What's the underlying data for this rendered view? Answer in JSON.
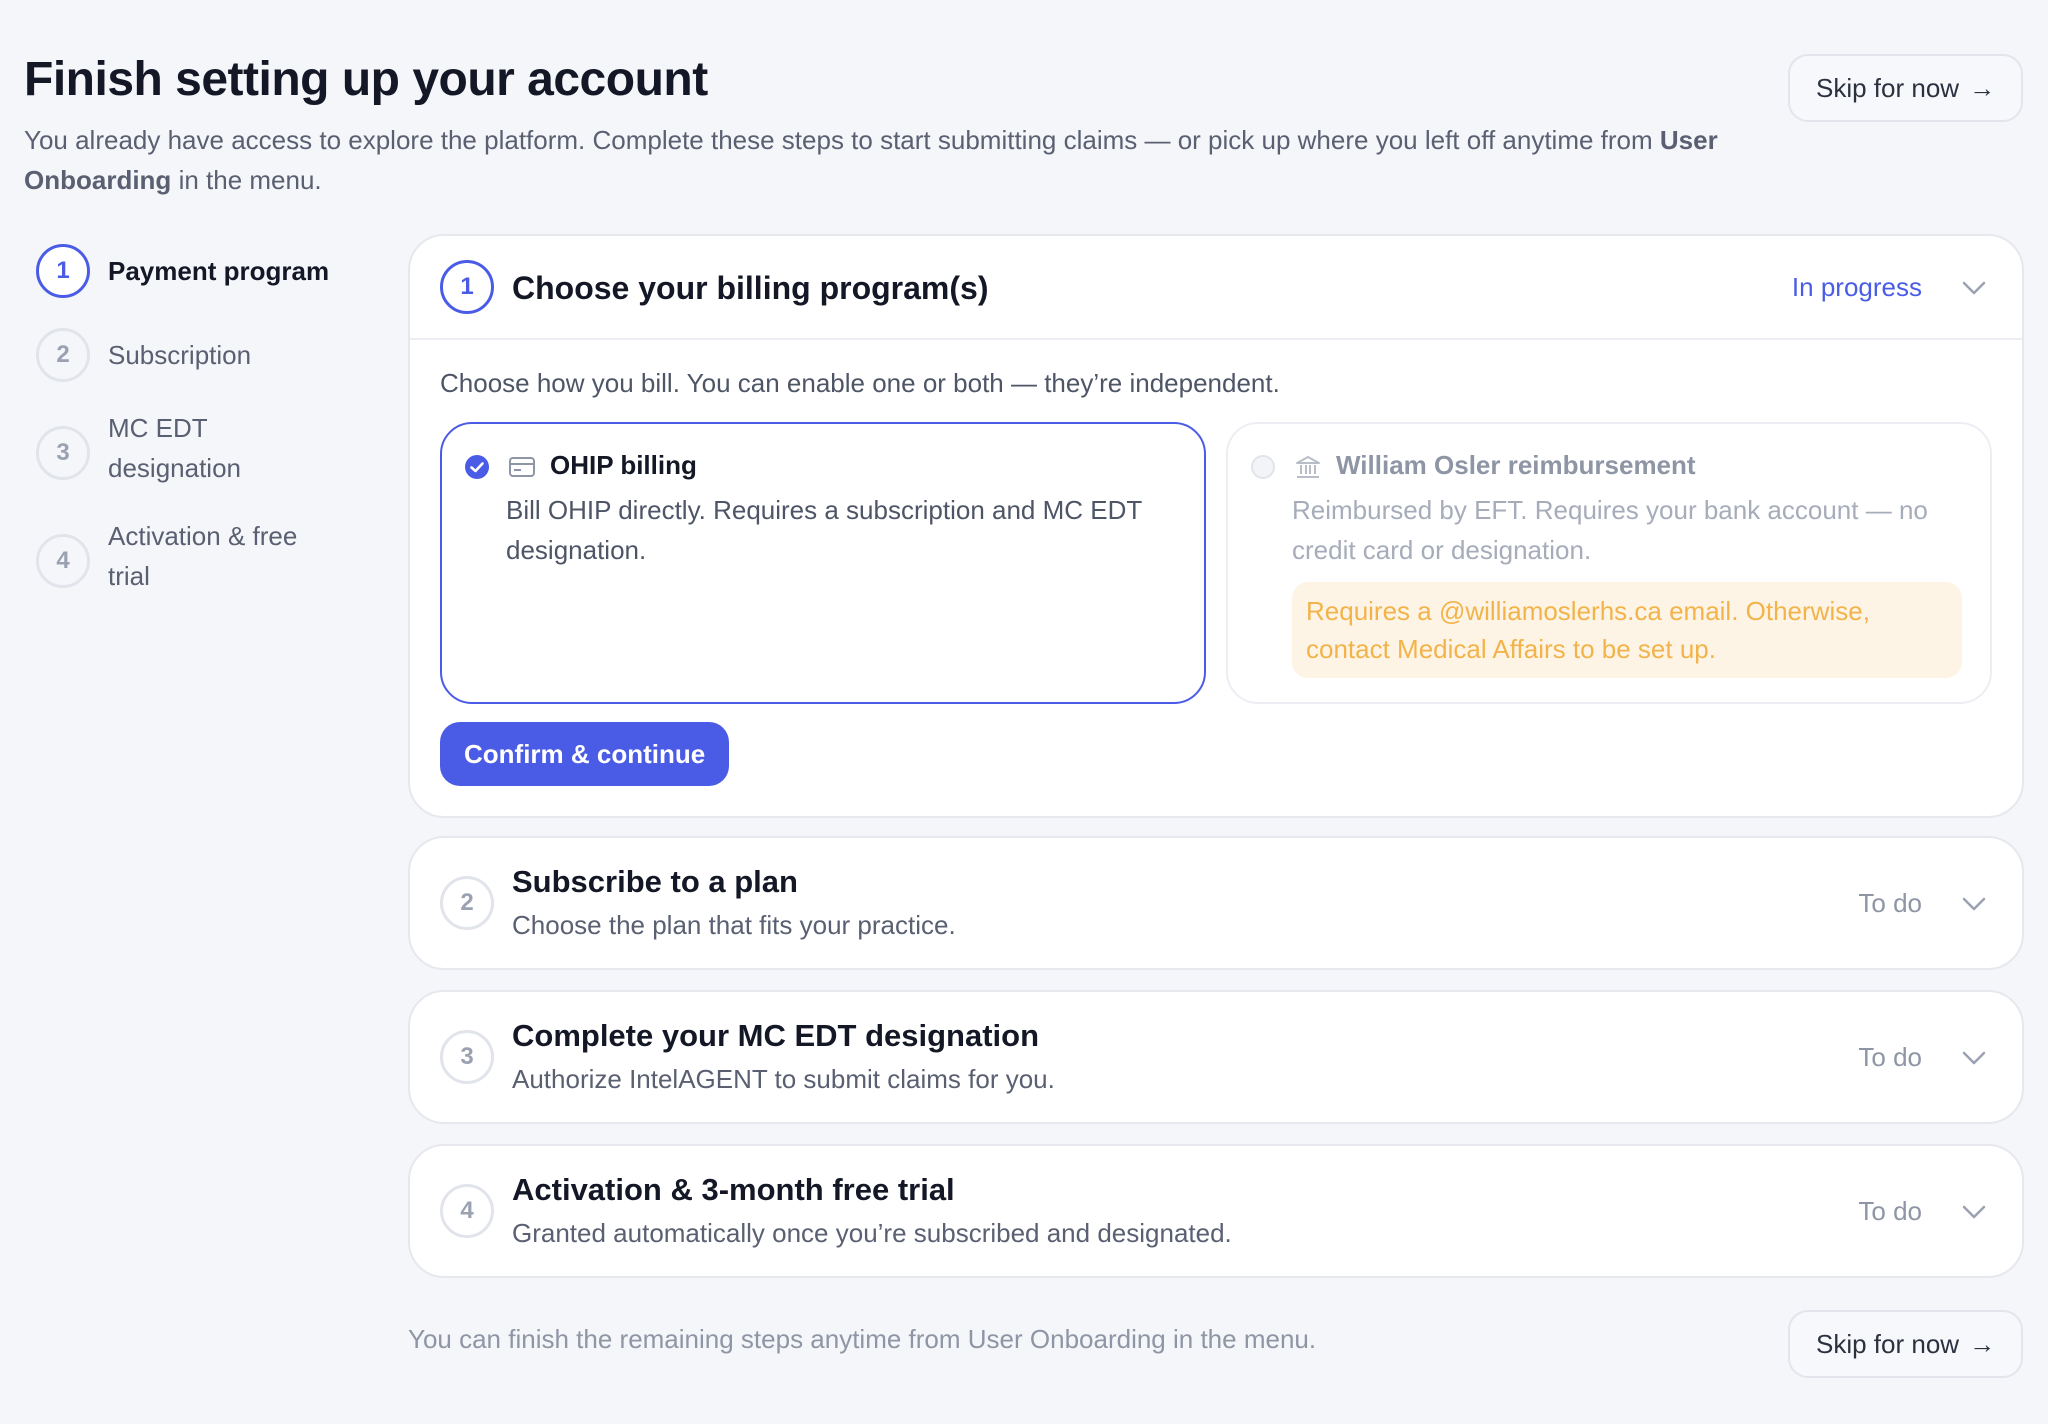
{
  "header": {
    "title": "Finish setting up your account",
    "subtitle_text": "You already have access to explore the platform. Complete these steps to start submitting claims — or pick up where you left off anytime from",
    "subtitle_link": "User Onboarding",
    "subtitle_end": "in the menu.",
    "skip_label": "Skip for now",
    "skip_arrow": "→"
  },
  "stepper": {
    "steps": [
      {
        "num": "1",
        "label": "Payment program",
        "active": true
      },
      {
        "num": "2",
        "label": "Subscription",
        "active": false
      },
      {
        "num": "3",
        "label": "MC EDT designation",
        "active": false
      },
      {
        "num": "4",
        "label": "Activation & free trial",
        "active": false
      }
    ]
  },
  "step1": {
    "num": "1",
    "title": "Choose your billing program(s)",
    "status": "In progress",
    "intro": "Choose how you bill. You can enable one or both — they’re independent.",
    "options": [
      {
        "title": "OHIP billing",
        "description": "Bill OHIP directly. Requires a subscription and MC EDT designation.",
        "selected": true,
        "icon": "credit-card-icon"
      },
      {
        "title": "William Osler reimbursement",
        "description": "Reimbursed by EFT. Requires your bank account — no credit card or designation.",
        "selected": false,
        "icon": "bank-icon",
        "warning": "Requires a @williamoslerhs.ca email. Otherwise, contact Medical Affairs to be set up."
      }
    ],
    "confirm_label": "Confirm & continue"
  },
  "steps_rest": [
    {
      "num": "2",
      "title": "Subscribe to a plan",
      "description": "Choose the plan that fits your practice.",
      "status": "To do"
    },
    {
      "num": "3",
      "title": "Complete your MC EDT designation",
      "description": "Authorize IntelAGENT to submit claims for you.",
      "status": "To do"
    },
    {
      "num": "4",
      "title": "Activation & 3-month free trial",
      "description": "Granted automatically once you’re subscribed and designated.",
      "status": "To do"
    }
  ],
  "footer": {
    "note": "You can finish the remaining steps anytime from User Onboarding in the menu.",
    "skip_label": "Skip for now",
    "skip_arrow": "→"
  },
  "colors": {
    "accent": "#4a5ce6",
    "background": "#f5f6fa",
    "warning_text": "#f2b44a",
    "warning_bg": "#fdf4e6"
  }
}
